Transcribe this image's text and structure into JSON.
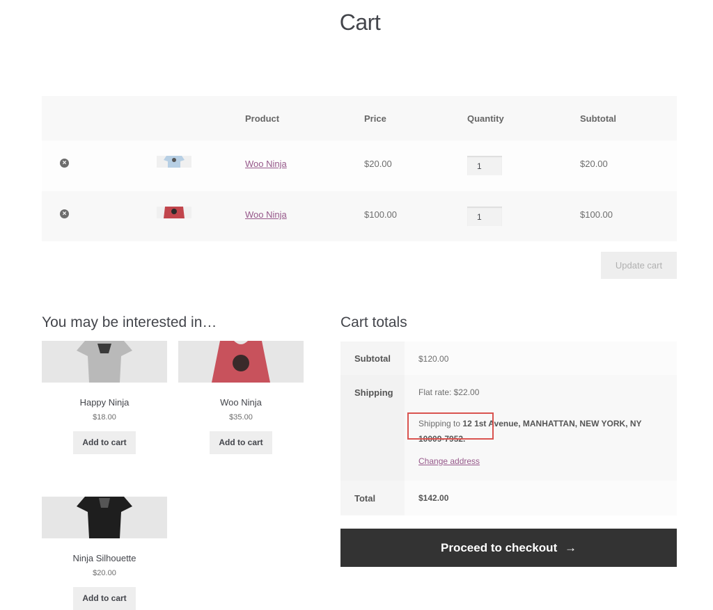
{
  "page": {
    "title": "Cart"
  },
  "cart": {
    "headers": {
      "product": "Product",
      "price": "Price",
      "quantity": "Quantity",
      "subtotal": "Subtotal"
    },
    "items": [
      {
        "name": "Woo Ninja",
        "price": "$20.00",
        "quantity": "1",
        "subtotal": "$20.00",
        "thumb_color": "#b7cfe4"
      },
      {
        "name": "Woo Ninja",
        "price": "$100.00",
        "quantity": "1",
        "subtotal": "$100.00",
        "thumb_color": "#c1454c"
      }
    ],
    "remove_icon": "close-circle-icon",
    "update_label": "Update cart"
  },
  "related": {
    "heading": "You may be interested in…",
    "products": [
      {
        "name": "Happy Ninja",
        "price": "$18.00",
        "button": "Add to cart",
        "shirt_color": "#b9b9b9"
      },
      {
        "name": "Woo Ninja",
        "price": "$35.00",
        "button": "Add to cart",
        "shirt_color": "#c8525c"
      },
      {
        "name": "Ninja Silhouette",
        "price": "$20.00",
        "button": "Add to cart",
        "shirt_color": "#1e1e1e"
      }
    ]
  },
  "totals": {
    "heading": "Cart totals",
    "subtotal_label": "Subtotal",
    "subtotal_value": "$120.00",
    "shipping_label": "Shipping",
    "shipping_method": "Flat rate: $22.00",
    "shipping_to_prefix": "Shipping to",
    "shipping_address_line1": "12 1st Avenue, MANHATTAN, NEW YORK, NY",
    "shipping_address_line2": "10009-7952.",
    "change_address": "Change address",
    "total_label": "Total",
    "total_value": "$142.00"
  },
  "checkout": {
    "label": "Proceed to checkout",
    "arrow": "→"
  },
  "colors": {
    "link": "#96588a",
    "highlight": "#d9534f",
    "checkout_bg": "#333333"
  }
}
